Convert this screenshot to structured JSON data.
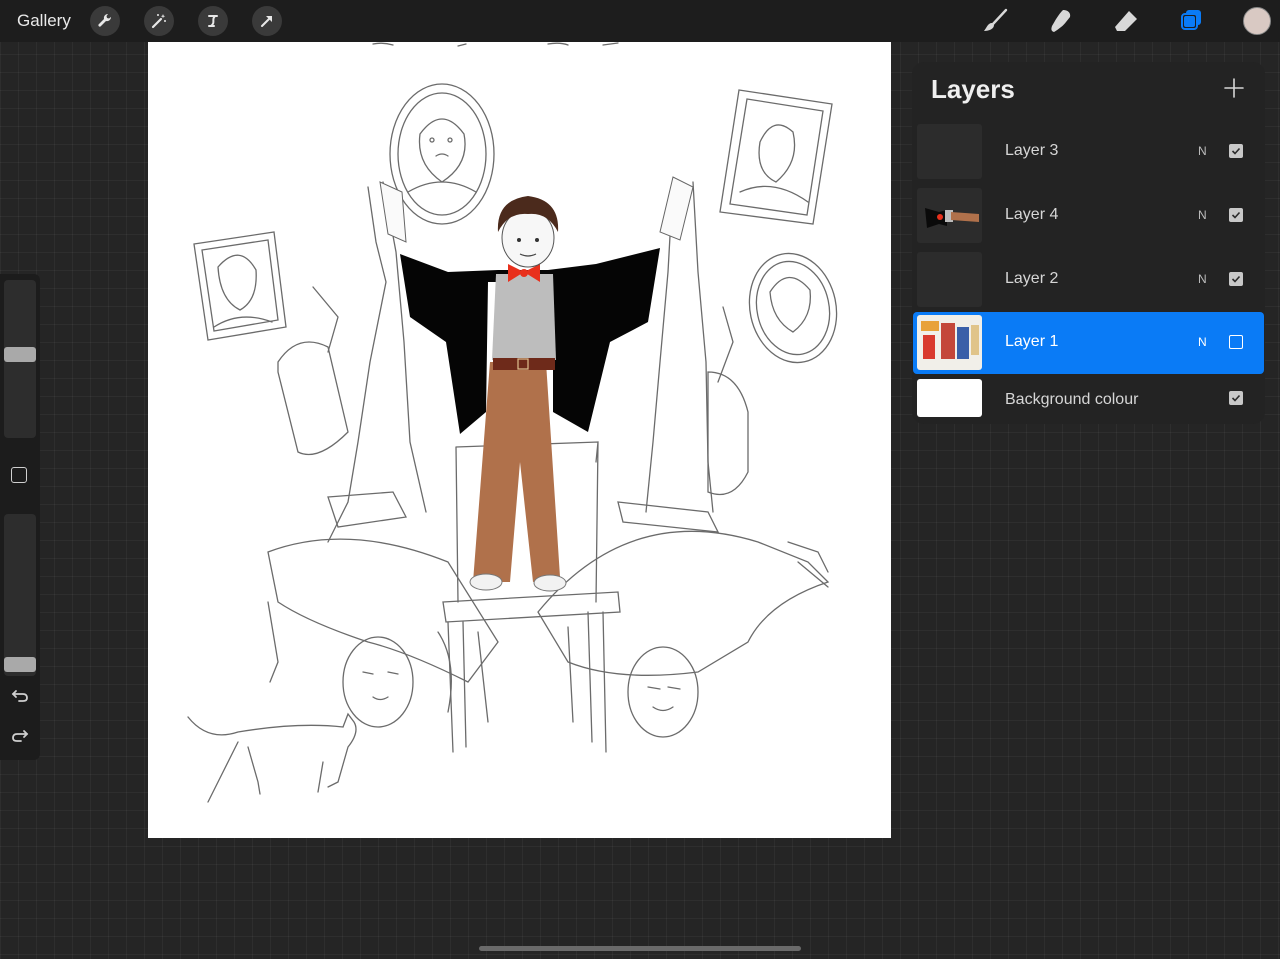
{
  "topbar": {
    "gallery_label": "Gallery",
    "left_tools": [
      "wrench-icon",
      "magic-wand-icon",
      "selection-icon",
      "transform-arrow-icon"
    ],
    "right_tools": [
      "brush-icon",
      "smudge-icon",
      "eraser-icon",
      "layers-icon"
    ],
    "active_color": "#d9c9c3"
  },
  "layers_panel": {
    "title": "Layers",
    "add_button": "plus-icon",
    "layers": [
      {
        "name": "Layer 3",
        "mode": "N",
        "visible": true,
        "selected": false
      },
      {
        "name": "Layer 4",
        "mode": "N",
        "visible": true,
        "selected": false
      },
      {
        "name": "Layer 2",
        "mode": "N",
        "visible": true,
        "selected": false
      },
      {
        "name": "Layer 1",
        "mode": "N",
        "visible": false,
        "selected": true
      },
      {
        "name": "Background colour",
        "mode": "",
        "visible": true,
        "selected": false
      }
    ]
  },
  "sidebar": {
    "brush_size": 0.78,
    "brush_opacity": 0.12
  },
  "colors": {
    "accent": "#0a7bf6",
    "panel": "#232323",
    "canvas": "#ffffff"
  }
}
